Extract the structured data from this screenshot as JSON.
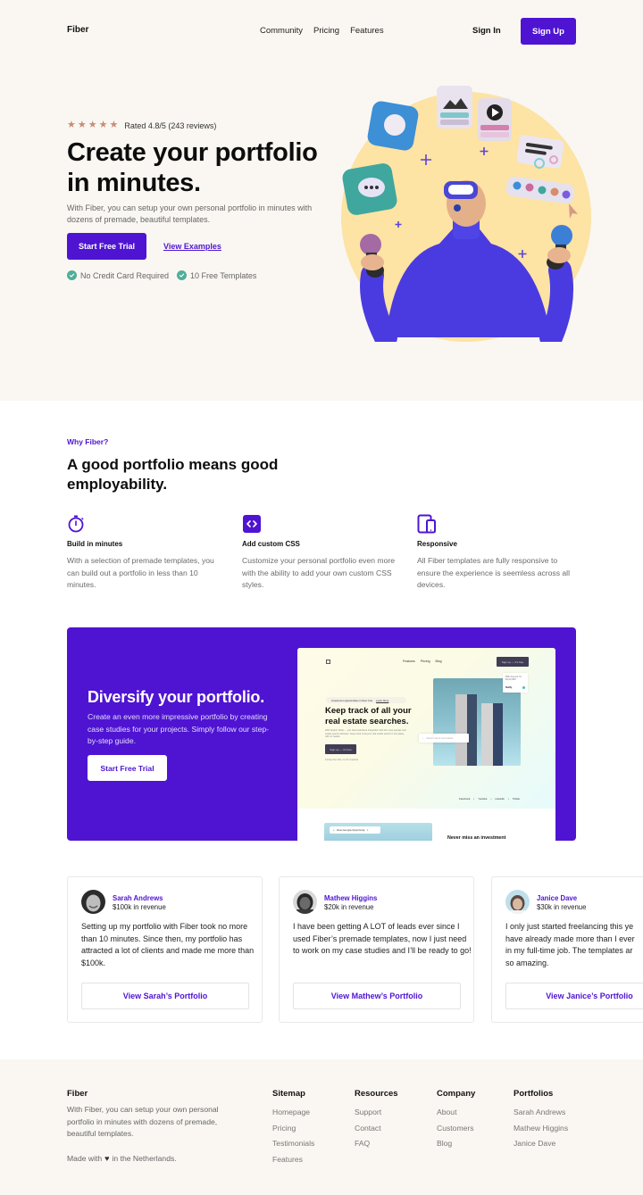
{
  "colors": {
    "brand": "#4f14d2",
    "hero_bg": "#faf7f2",
    "star": "#c98b74",
    "check": "#4fae9a"
  },
  "nav": {
    "logo": "Fiber",
    "links": [
      "Community",
      "Pricing",
      "Features"
    ],
    "sign_in": "Sign In",
    "sign_up": "Sign Up"
  },
  "hero": {
    "rating_stars": 5,
    "rating_text": "Rated 4.8/5 (243 reviews)",
    "title": "Create your portfolio in minutes.",
    "subtitle": "With Fiber, you can setup your own personal portfolio in minutes with dozens of premade, beautiful templates.",
    "primary_cta": "Start Free Trial",
    "secondary_cta": "View Examples",
    "checks": [
      "No Credit Card Required",
      "10 Free Templates"
    ]
  },
  "why": {
    "kicker": "Why Fiber?",
    "title": "A good portfolio means good employability.",
    "features": [
      {
        "icon": "stopwatch-icon",
        "title": "Build in minutes",
        "desc": "With a selection of premade templates, you can build out a portfolio in less than 10 minutes."
      },
      {
        "icon": "code-icon",
        "title": "Add custom CSS",
        "desc": "Customize your personal portfolio even more with the ability to add your own custom CSS styles."
      },
      {
        "icon": "devices-icon",
        "title": "Responsive",
        "desc": "All Fiber templates are fully responsive to ensure the experience is seemless across all devices."
      }
    ]
  },
  "promo": {
    "title": "Diversify your portfolio.",
    "subtitle": "Create an even more impressive portfolio by creating case studies for your projects. Simply follow our step-by-step guide.",
    "cta": "Start Free Trial",
    "mock": {
      "nav": [
        "Features",
        "Pricing",
        "Blog"
      ],
      "signup": "Sign up — it's free",
      "pill": "Investment opportunities in New York",
      "pill_link": "Learn More",
      "title": "Keep track of all your real estate searches.",
      "desc": "With Search State — you have seamless integration with the most popular real estate search websites. Keep track of all your real estate search in one place, with no hassle.",
      "button": "Sign up — it's free",
      "note": "14 day free trial, no CC required",
      "card_address": "85th Avenue St.",
      "card_price": "$1,00,680",
      "card_notify": "Notify",
      "search_placeholder": "Search saved real estates",
      "social": [
        "Facebook",
        "Youtube",
        "LinkedIn",
        "Twitter"
      ],
      "tag": "View Georgia Opportunity",
      "heading2": "Never miss an investment"
    }
  },
  "testimonials": [
    {
      "name": "Sarah Andrews",
      "revenue": "$100k in revenue",
      "quote": "Setting up my portfolio with Fiber took no more than 10 minutes. Since then, my portfolio has attracted a lot of clients and made me more than $100k.",
      "cta": "View Sarah’s Portfolio"
    },
    {
      "name": "Mathew Higgins",
      "revenue": "$20k in revenue",
      "quote": "I have been getting A LOT of leads ever since I used Fiber’s premade templates, now I just need to work on my case studies and I’ll be ready to go!",
      "cta": "View Mathew’s Portfolio"
    },
    {
      "name": "Janice Dave",
      "revenue": "$30k in revenue",
      "quote_lines": [
        "I only just started freelancing this ye",
        "have already made more than I ever",
        "in my full-time job. The templates ar",
        "so amazing."
      ],
      "cta": "View Janice’s Portfolio"
    }
  ],
  "footer": {
    "brand": "Fiber",
    "about": "With Fiber, you can setup your own personal portfolio in minutes with dozens of premade, beautiful templates.",
    "made_prefix": "Made with",
    "made_suffix": "in the Netherlands.",
    "columns": [
      {
        "title": "Sitemap",
        "links": [
          "Homepage",
          "Pricing",
          "Testimonials",
          "Features"
        ]
      },
      {
        "title": "Resources",
        "links": [
          "Support",
          "Contact",
          "FAQ"
        ]
      },
      {
        "title": "Company",
        "links": [
          "About",
          "Customers",
          "Blog"
        ]
      },
      {
        "title": "Portfolios",
        "links": [
          "Sarah Andrews",
          "Mathew Higgins",
          "Janice Dave"
        ]
      }
    ]
  }
}
